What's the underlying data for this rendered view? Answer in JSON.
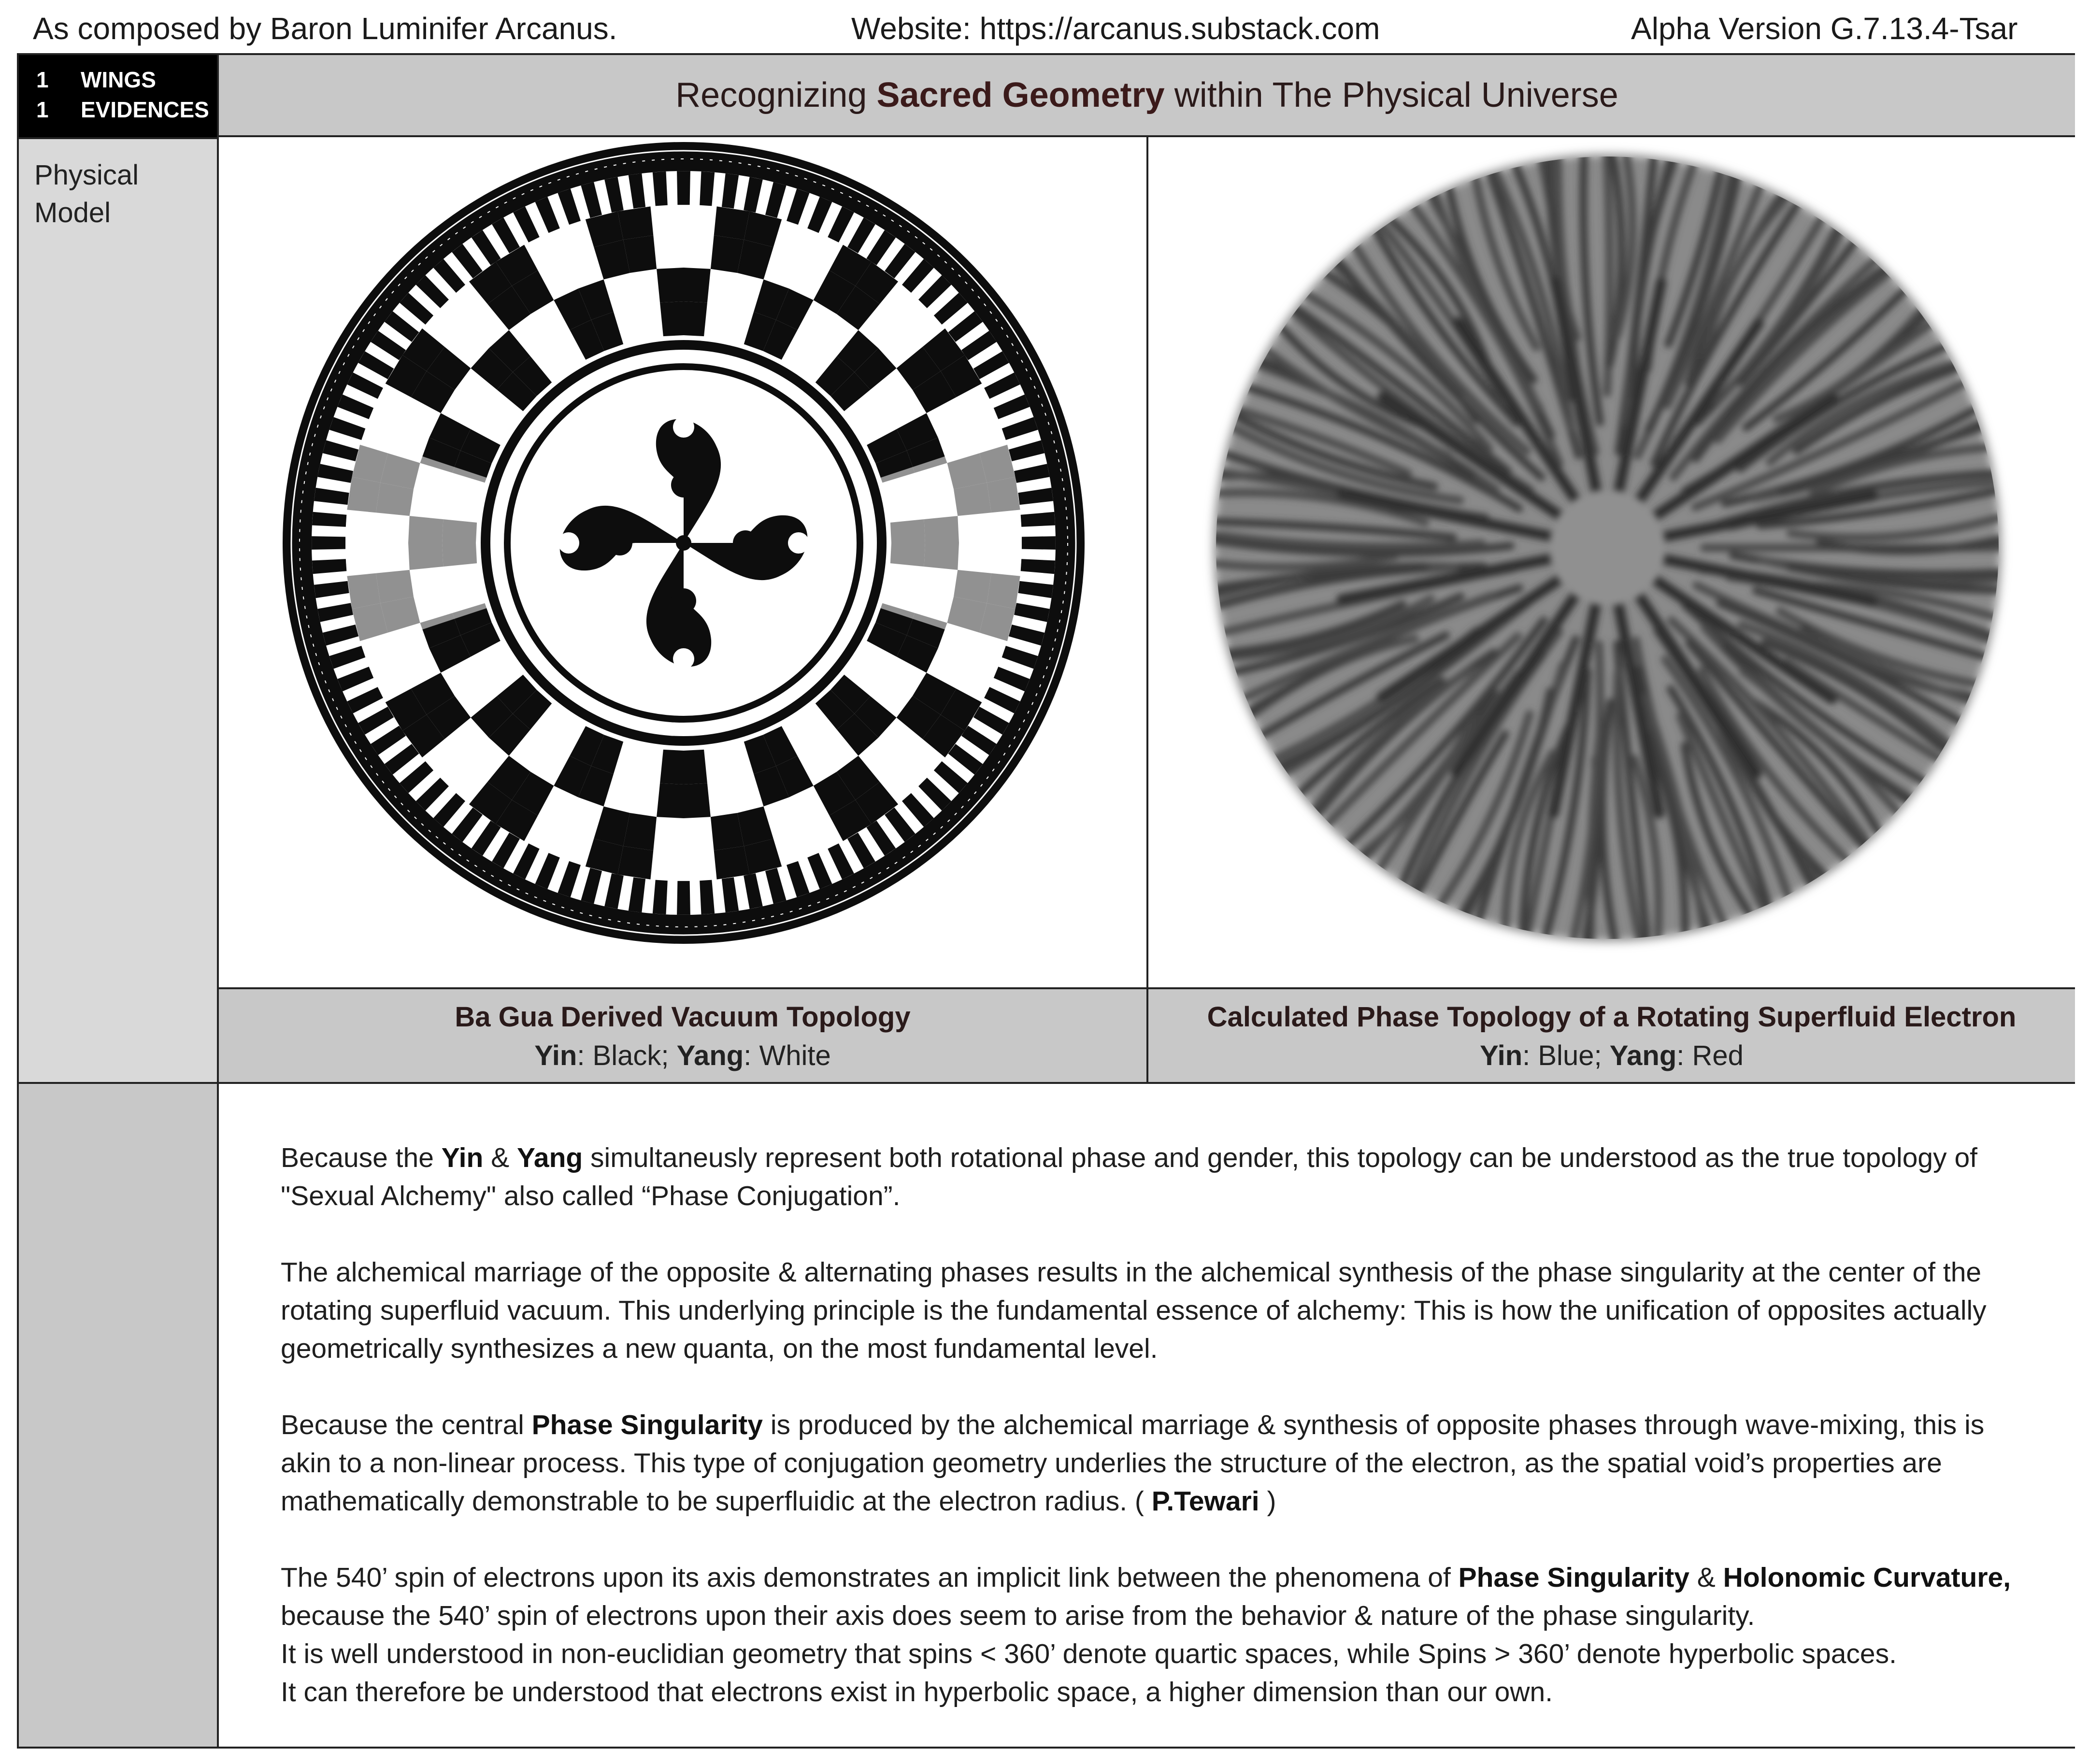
{
  "header": {
    "author": "As composed by Baron Luminifer Arcanus.",
    "website": "Website: https://arcanus.substack.com",
    "version": "Alpha Version G.7.13.4-Tsar"
  },
  "badge": {
    "rows": [
      {
        "num": "1",
        "label": "WINGS"
      },
      {
        "num": "1",
        "label": "EVIDENCES"
      }
    ]
  },
  "title": {
    "prefix": "Recognizing ",
    "bold": "Sacred Geometry",
    "suffix": " within The Physical Universe"
  },
  "section_label": "Physical Model",
  "captions": {
    "left": {
      "title": "Ba Gua Derived Vacuum Topology",
      "yin": "Yin",
      "yin_text": ": Black; ",
      "yang": "Yang",
      "yang_text": ": White"
    },
    "right": {
      "title": "Calculated Phase Topology of a Rotating Superfluid Electron",
      "yin": "Yin",
      "yin_text": ": Blue; ",
      "yang": "Yang",
      "yang_text": ": Red"
    }
  },
  "body": {
    "p1_a": "Because the ",
    "p1_yin": "Yin",
    "p1_b": " & ",
    "p1_yang": "Yang",
    "p1_c": " simultaneusly represent both rotational phase and gender, this topology can be understood as the true topology of \"Sexual Alchemy\" also called “Phase Conjugation”.",
    "p2": "The alchemical marriage of the opposite & alternating phases results in the alchemical synthesis of the phase singularity at the center of the rotating superfluid vacuum. This underlying principle is the fundamental essence of alchemy: This is how the unification of opposites actually geometrically synthesizes a new quanta, on the most fundamental level.",
    "p3_a": "Because the central ",
    "p3_bold": "Phase Singularity",
    "p3_b": " is produced by the alchemical marriage & synthesis of opposite phases through wave-mixing, this is akin to a non-linear process. This type of conjugation geometry underlies the structure of the electron, as the spatial void’s properties are mathematically demonstrable to be superfluidic at the electron radius. ( ",
    "p3_cite": "P.Tewari",
    "p3_c": " )",
    "p4_a": "The 540’ spin of electrons upon its axis demonstrates an implicit link between the phenomena of ",
    "p4_b1": "Phase Singularity",
    "p4_b": " & ",
    "p4_b2": "Holonomic Curvature,",
    "p4_c": " because the 540’ spin of electrons upon their axis does seem to arise from the behavior & nature of the phase singularity.",
    "p4_line2": "It is well understood in non-euclidian geometry that spins < 360’ denote quartic spaces, while Spins > 360’ denote hyperbolic spaces.",
    "p4_line3": "It can therefore be understood that electrons exist in hyperbolic space, a higher dimension than our own."
  }
}
